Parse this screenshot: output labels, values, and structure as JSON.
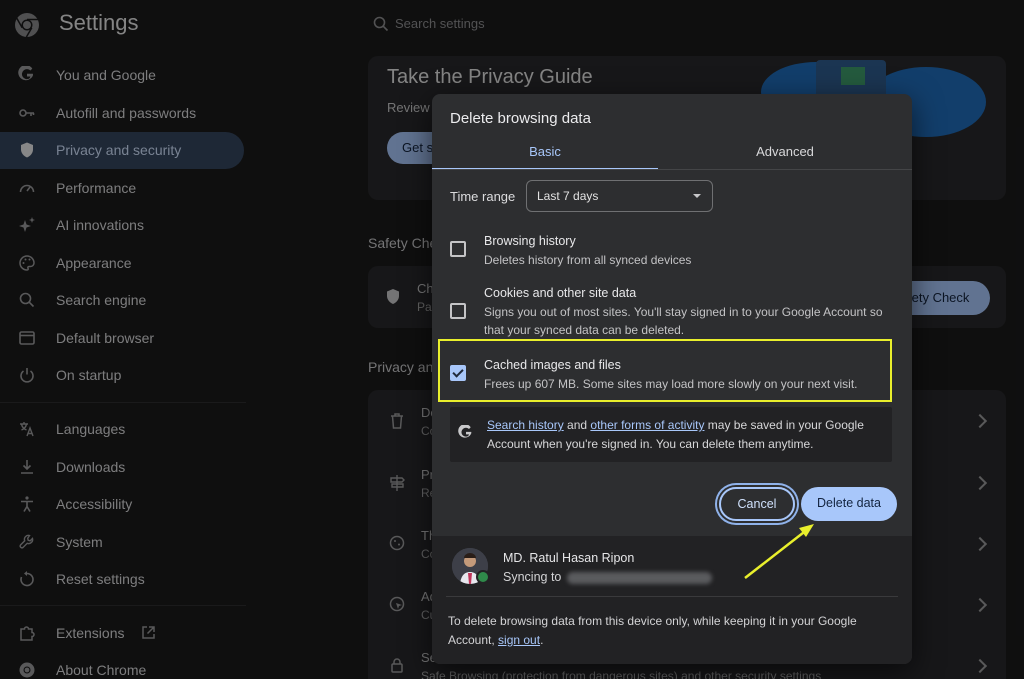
{
  "header": {
    "title": "Settings",
    "search_placeholder": "Search settings"
  },
  "sidebar": {
    "items": [
      {
        "label": "You and Google",
        "icon": "google-g-icon"
      },
      {
        "label": "Autofill and passwords",
        "icon": "key-icon"
      },
      {
        "label": "Privacy and security",
        "icon": "shield-icon",
        "active": true
      },
      {
        "label": "Performance",
        "icon": "speedometer-icon"
      },
      {
        "label": "AI innovations",
        "icon": "sparkle-icon"
      },
      {
        "label": "Appearance",
        "icon": "palette-icon"
      },
      {
        "label": "Search engine",
        "icon": "search-icon"
      },
      {
        "label": "Default browser",
        "icon": "browser-window-icon"
      },
      {
        "label": "On startup",
        "icon": "power-icon"
      },
      {
        "label": "Languages",
        "icon": "translate-icon"
      },
      {
        "label": "Downloads",
        "icon": "download-icon"
      },
      {
        "label": "Accessibility",
        "icon": "accessibility-icon"
      },
      {
        "label": "System",
        "icon": "wrench-icon"
      },
      {
        "label": "Reset settings",
        "icon": "reset-icon"
      },
      {
        "label": "Extensions",
        "icon": "puzzle-icon"
      },
      {
        "label": "About Chrome",
        "icon": "chrome-icon"
      }
    ]
  },
  "background": {
    "privacy_guide_title": "Take the Privacy Guide",
    "privacy_guide_sub": "Review",
    "get_started_partial": "Get s",
    "safety_check_section": "Safety Che",
    "safety_check_row_title": "Ch",
    "safety_check_row_sub": "Pa",
    "safety_check_button": "fety Check",
    "privacy_section": "Privacy an",
    "rows": [
      {
        "t": "De",
        "s": "Co"
      },
      {
        "t": "Pr",
        "s": "Re"
      },
      {
        "t": "Th",
        "s": "Co"
      },
      {
        "t": "Ad",
        "s": "Cu"
      },
      {
        "t": "Se",
        "s": ""
      }
    ],
    "safe_browsing_text": "Safe Browsing (protection from dangerous sites) and other security settings"
  },
  "dialog": {
    "title": "Delete browsing data",
    "tabs": [
      "Basic",
      "Advanced"
    ],
    "time_range_label": "Time range",
    "time_range_value": "Last 7 days",
    "options": [
      {
        "title": "Browsing history",
        "desc": "Deletes history from all synced devices",
        "checked": false
      },
      {
        "title": "Cookies and other site data",
        "desc": "Signs you out of most sites. You'll stay signed in to your Google Account so that your synced data can be deleted.",
        "checked": false
      },
      {
        "title": "Cached images and files",
        "desc": "Frees up 607 MB. Some sites may load more slowly on your next visit.",
        "checked": true
      }
    ],
    "google_note": {
      "link1": "Search history",
      "mid1": " and ",
      "link2": "other forms of activity",
      "rest": " may be saved in your Google Account when you're signed in. You can delete them anytime."
    },
    "cancel_label": "Cancel",
    "delete_label": "Delete data",
    "account": {
      "name": "MD. Ratul Hasan Ripon",
      "syncing_label": "Syncing to",
      "footer_text": "To delete browsing data from this device only, while keeping it in your Google Account, ",
      "sign_out": "sign out",
      "footer_end": "."
    }
  },
  "colors": {
    "accent": "#a8c7fa",
    "highlight": "#e9ef2c",
    "background": "#1a1a1b",
    "dialog": "#2d2e30"
  }
}
